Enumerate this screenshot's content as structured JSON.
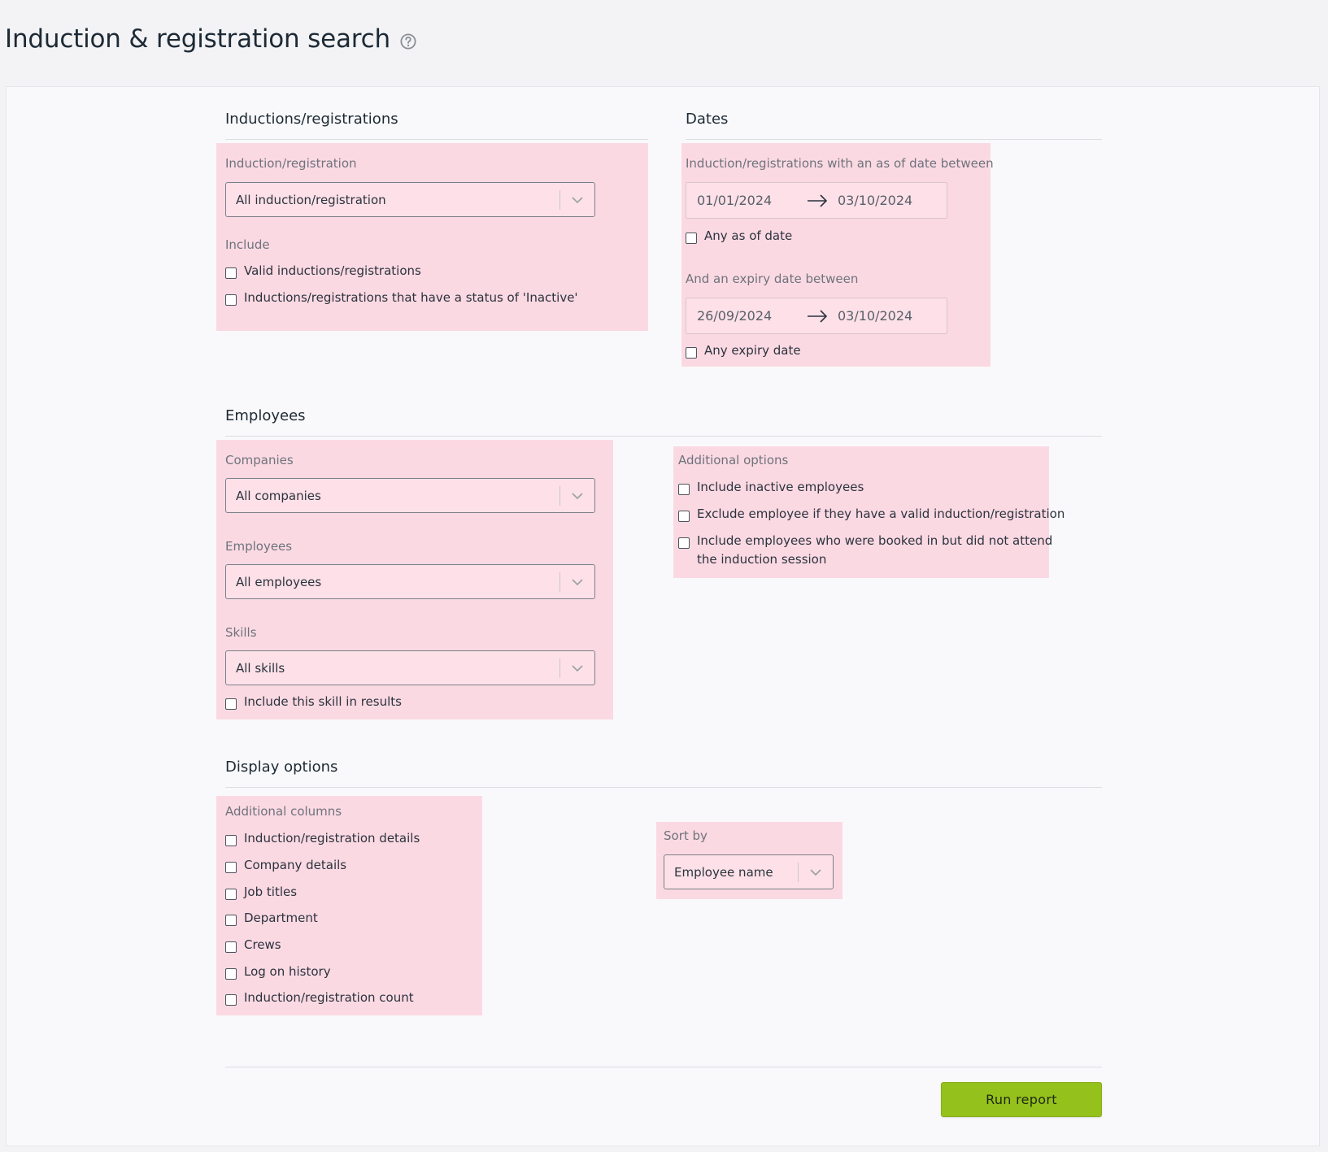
{
  "page": {
    "title": "Induction & registration search"
  },
  "inductions": {
    "heading": "Inductions/registrations",
    "type_label": "Induction/registration",
    "type_value": "All induction/registration",
    "include_label": "Include",
    "include_valid": "Valid inductions/registrations",
    "include_inactive": "Inductions/registrations that have a status of 'Inactive'"
  },
  "dates": {
    "heading": "Dates",
    "as_of_label": "Induction/registrations with an as of date between",
    "as_of_from": "01/01/2024",
    "as_of_to": "03/10/2024",
    "any_as_of": "Any as of date",
    "expiry_label": "And an expiry date between",
    "expiry_from": "26/09/2024",
    "expiry_to": "03/10/2024",
    "any_expiry": "Any expiry date"
  },
  "employees": {
    "heading": "Employees",
    "companies_label": "Companies",
    "companies_value": "All companies",
    "employees_label": "Employees",
    "employees_value": "All employees",
    "skills_label": "Skills",
    "skills_value": "All skills",
    "include_skill": "Include this skill in results",
    "additional_label": "Additional options",
    "opt_inactive": "Include inactive employees",
    "opt_exclude_valid": "Exclude employee if they have a valid induction/registration",
    "opt_booked_line1": "Include employees who were booked in but did not attend",
    "opt_booked_line2": "the induction session"
  },
  "display": {
    "heading": "Display options",
    "columns_label": "Additional columns",
    "columns": [
      "Induction/registration details",
      "Company details",
      "Job titles",
      "Department",
      "Crews",
      "Log on history",
      "Induction/registration count"
    ],
    "sort_label": "Sort by",
    "sort_value": "Employee name"
  },
  "actions": {
    "run_report": "Run report"
  },
  "colors": {
    "highlight": "#fbd9e3",
    "accent_button": "#95c11c",
    "panel": "#f9f9fb",
    "background": "#f3f3f6"
  }
}
